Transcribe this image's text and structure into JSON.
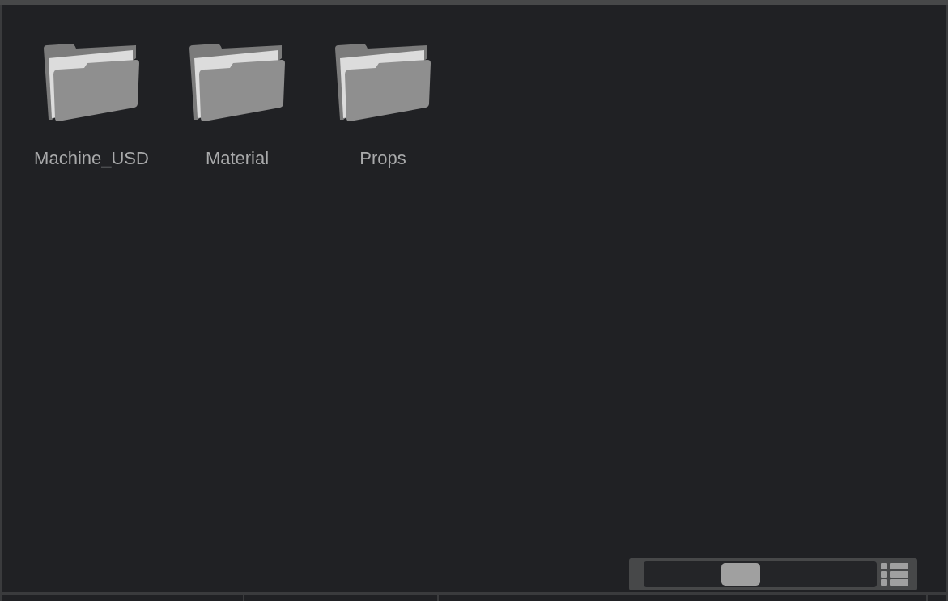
{
  "folders": [
    {
      "name": "Machine_USD"
    },
    {
      "name": "Material"
    },
    {
      "name": "Props"
    }
  ],
  "zoom_slider": {
    "level": 0.4
  }
}
